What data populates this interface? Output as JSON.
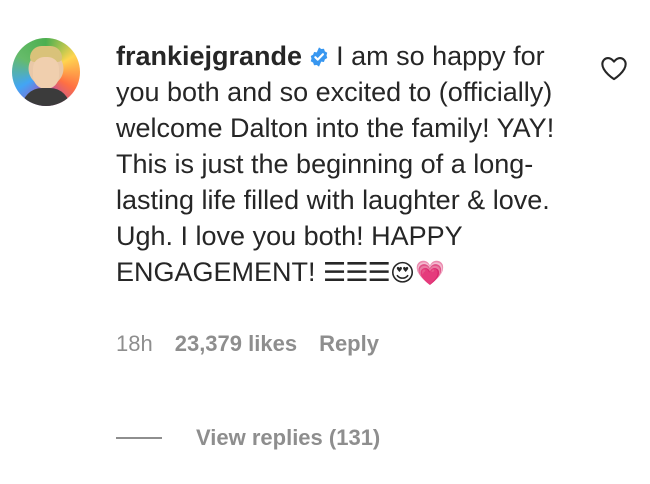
{
  "comment": {
    "username": "frankiejgrande",
    "verified_icon": "verified-badge-icon",
    "text": "I am so happy for you both and so excited to (officially) welcome Dalton into the family! YAY! This is just the beginning of a long-lasting life filled with laughter & love. Ugh. I love you both! HAPPY ENGAGEMENT!",
    "blocks": "☰☰☰",
    "emojis": "😍💗",
    "time": "18h",
    "likes": "23,379 likes",
    "reply_label": "Reply",
    "view_replies": "View replies (131)"
  },
  "colors": {
    "verified": "#3897f0",
    "muted": "#8e8e8e",
    "text": "#262626"
  },
  "icons": [
    "avatar",
    "verified-badge-icon",
    "heart-icon"
  ]
}
